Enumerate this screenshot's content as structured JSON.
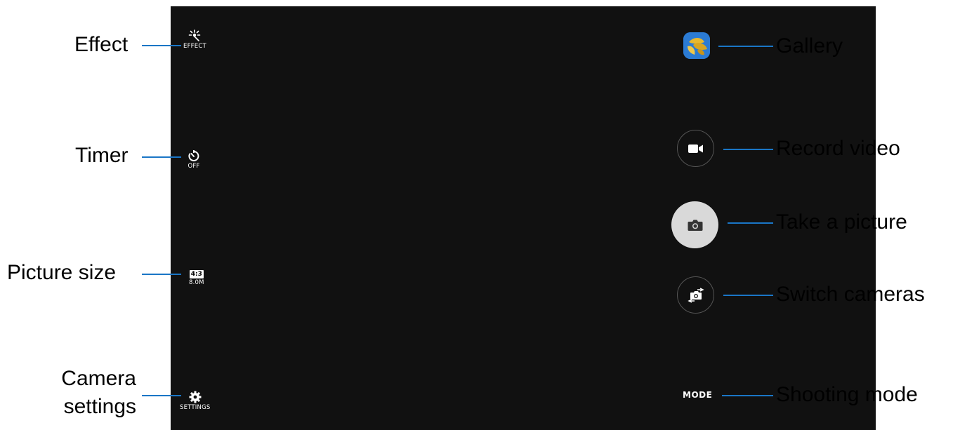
{
  "left_controls": {
    "effect": {
      "icon": "effect-sparkle-icon",
      "sub": "EFFECT"
    },
    "timer": {
      "icon": "timer-icon",
      "sub": "OFF"
    },
    "picture_size": {
      "icon": "aspect-ratio-icon",
      "ratio": "4:3",
      "sub": "8.0M"
    },
    "settings": {
      "icon": "gear-icon",
      "sub": "SETTINGS"
    }
  },
  "right_controls": {
    "gallery": {
      "icon": "gallery-thumbnail-icon"
    },
    "record_video": {
      "icon": "video-camera-icon"
    },
    "take_picture": {
      "icon": "camera-icon"
    },
    "switch_cameras": {
      "icon": "switch-camera-icon"
    },
    "mode": {
      "label": "MODE"
    }
  },
  "callouts": {
    "effect": "Effect",
    "timer": "Timer",
    "picture_size": "Picture size",
    "camera_settings_line1": "Camera",
    "camera_settings_line2": "settings",
    "gallery": "Gallery",
    "record_video": "Record video",
    "take_picture": "Take a picture",
    "switch_cameras": "Switch cameras",
    "shooting_mode": "Shooting mode"
  },
  "colors": {
    "screen_background": "#111111",
    "callout_line": "#1a76c6",
    "shutter_button": "#d9d9d9",
    "gallery_background": "#2b7bd4",
    "gallery_leaf": "#e8b82e"
  }
}
